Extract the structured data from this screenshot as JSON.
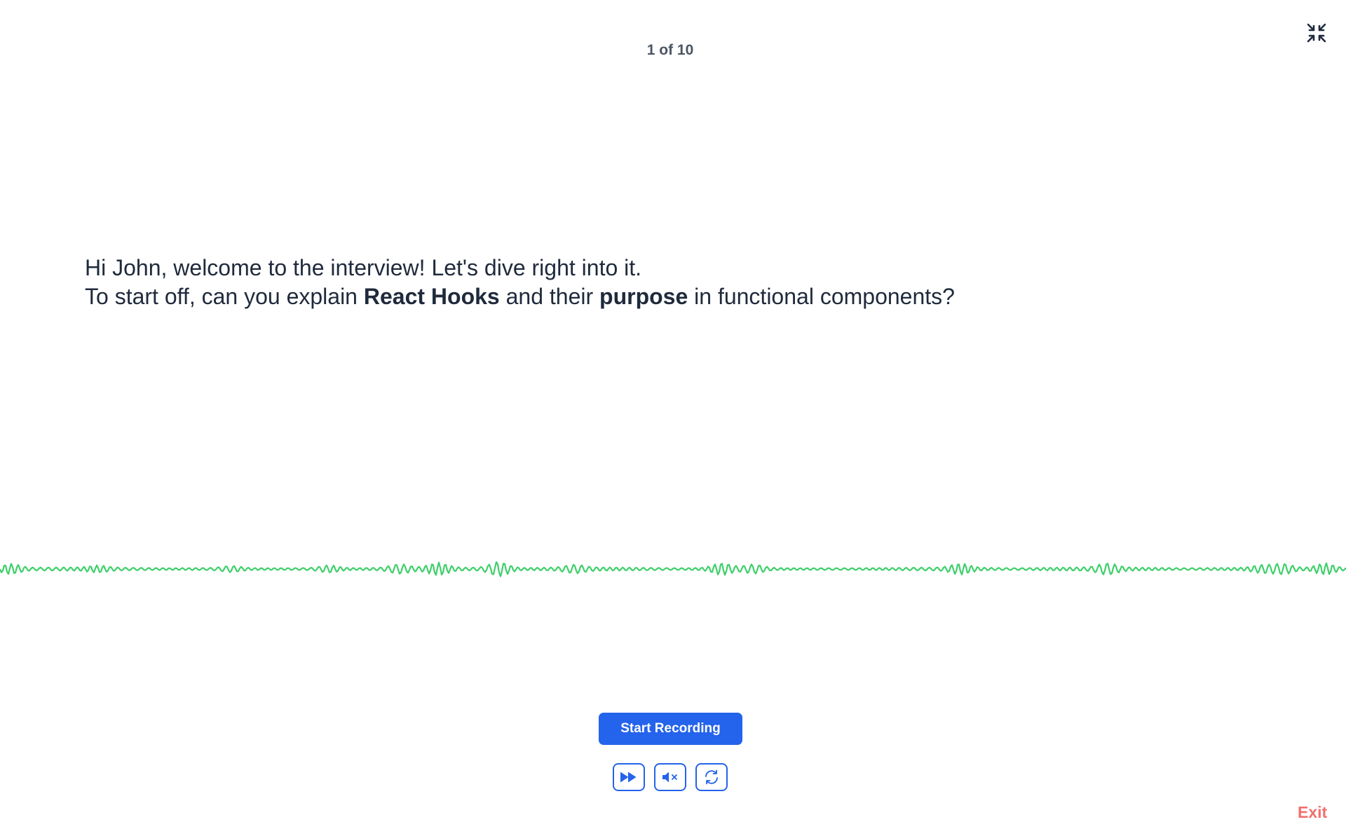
{
  "header": {
    "progress_text": "1 of 10",
    "collapse_icon": "collapse-fullscreen-icon"
  },
  "question": {
    "line1": "Hi John, welcome to the interview! Let's dive right into it.",
    "line2_part1": "To start off, can you explain ",
    "line2_bold1": "React Hooks",
    "line2_part2": " and their ",
    "line2_bold2": "purpose",
    "line2_part3": " in functional components?"
  },
  "waveform": {
    "color": "#3ecf6a"
  },
  "controls": {
    "record_label": "Start Recording",
    "skip_icon": "fast-forward-icon",
    "mute_icon": "speaker-muted-icon",
    "repeat_icon": "repeat-icon",
    "accent_color": "#2463eb"
  },
  "footer": {
    "exit_label": "Exit",
    "exit_color": "#f07070"
  }
}
